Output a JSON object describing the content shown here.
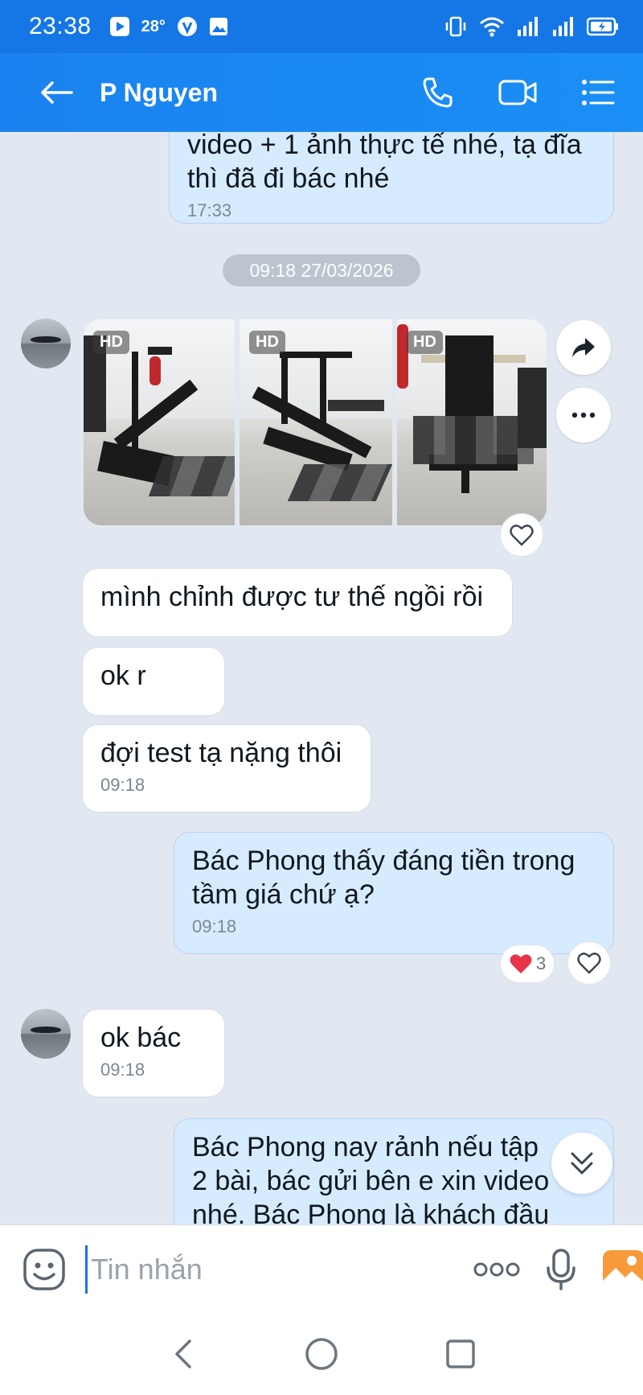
{
  "status_bar": {
    "time": "23:38",
    "temperature": "28°",
    "icons": [
      "media-icon",
      "vpn-icon",
      "image-icon",
      "vibrate-icon",
      "wifi-icon",
      "signal-icon",
      "signal-icon",
      "battery-icon"
    ]
  },
  "header": {
    "contact_name": "P Nguyen",
    "actions": [
      "phone-icon",
      "video-call-icon",
      "menu-icon"
    ]
  },
  "messages": {
    "m1": {
      "line1": "video + 1 ảnh thực tế nhé, tạ đĩa",
      "line2": "thì đã đi bác nhé",
      "time": "17:33"
    },
    "date_separator": "09:18 27/03/2026",
    "photos": {
      "badge": "HD",
      "count": 3
    },
    "m2": {
      "text": "mình chỉnh được tư thế ngồi rồi"
    },
    "m3": {
      "text": "ok r"
    },
    "m4": {
      "text": "đợi test tạ nặng thôi",
      "time": "09:18"
    },
    "m5": {
      "line1": "Bác Phong thấy đáng tiền trong",
      "line2": "tầm giá chứ ạ?",
      "time": "09:18",
      "reaction_count": "3"
    },
    "m6": {
      "text": "ok bác",
      "time": "09:18"
    },
    "m7": {
      "line1": "Bác Phong nay rảnh nếu tập",
      "line2": "2 bài, bác gửi bên e xin video",
      "line3": "nhé. Bác Phong là khách đầu"
    }
  },
  "input": {
    "placeholder": "Tin nhắn"
  },
  "colors": {
    "header": "#1a82f0",
    "out_bubble": "#d7ebfe",
    "background": "#e2e8f1",
    "heart": "#e8334a"
  }
}
